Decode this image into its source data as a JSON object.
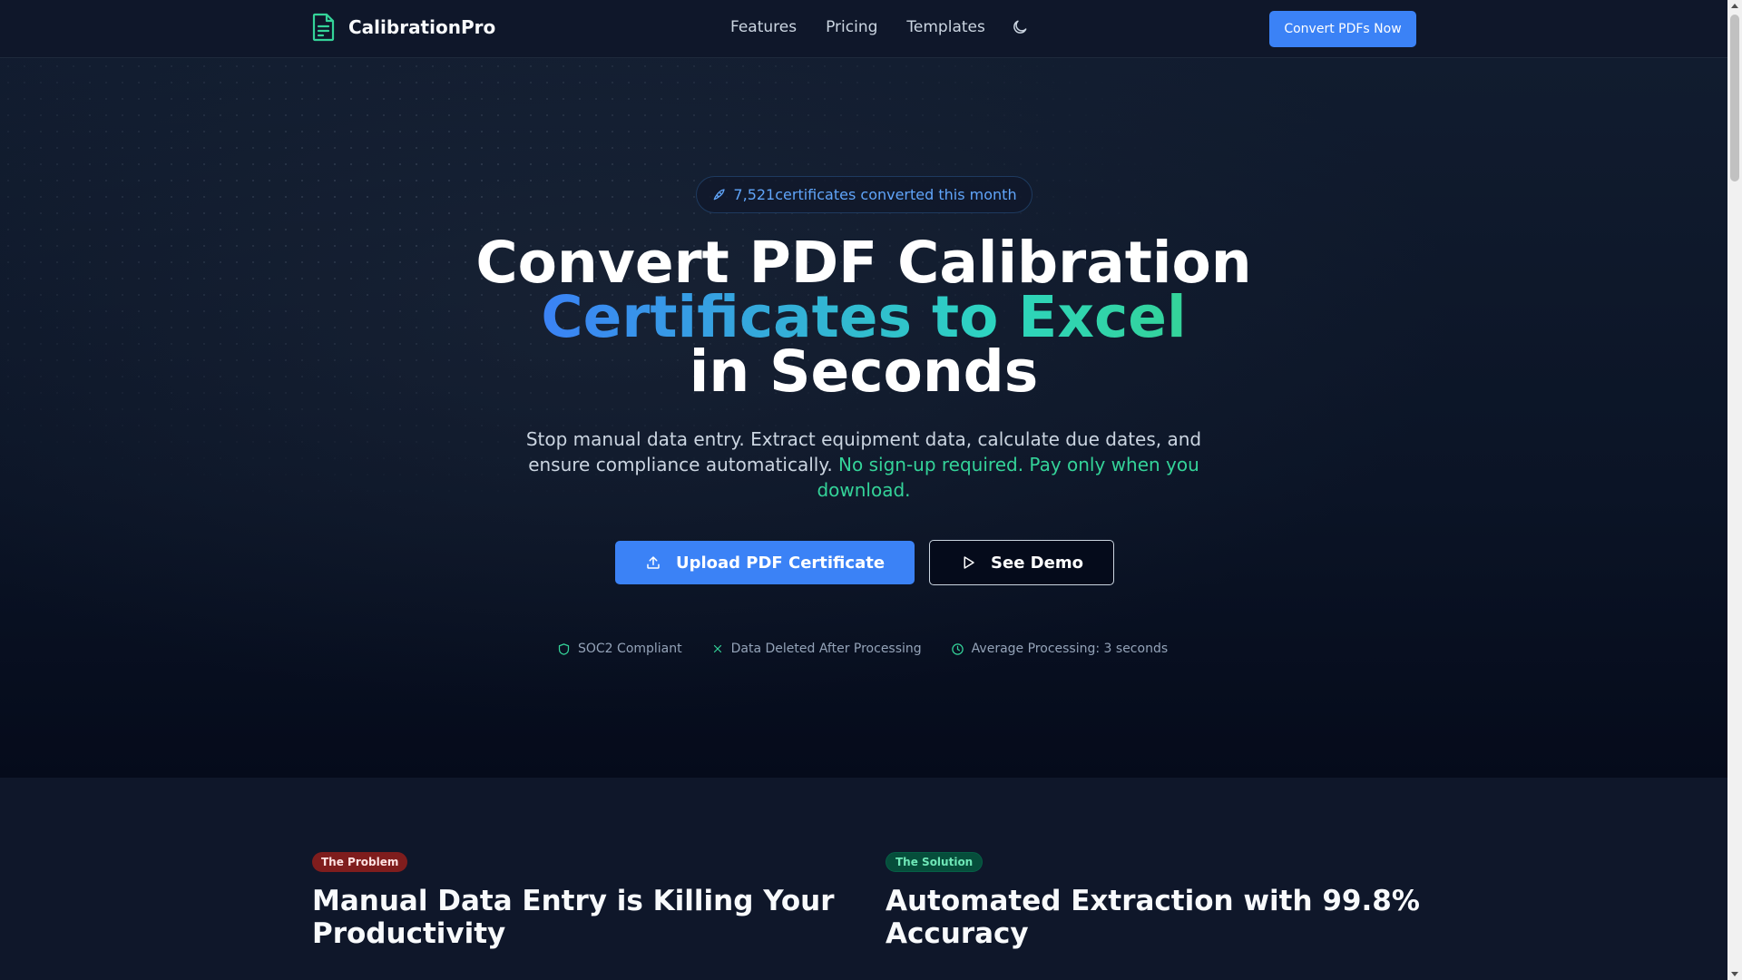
{
  "nav": {
    "brand": "CalibrationPro",
    "links": [
      "Features",
      "Pricing",
      "Templates"
    ],
    "cta": "Convert PDFs Now"
  },
  "hero": {
    "badge_count": "7,521",
    "badge_text": "certificates converted this month",
    "headline_line1": "Convert PDF Calibration",
    "headline_line2": "Certificates to Excel",
    "headline_line3": "in Seconds",
    "subcopy": "Stop manual data entry. Extract equipment data, calculate due dates, and ensure compliance automatically.",
    "subcopy_accent": "No sign-up required. Pay only when you download.",
    "upload_label": "Upload PDF Certificate",
    "demo_label": "See Demo",
    "trust": [
      "SOC2 Compliant",
      "Data Deleted After Processing",
      "Average Processing: 3 seconds"
    ]
  },
  "sections": {
    "problem_tag": "The Problem",
    "problem_title": "Manual Data Entry is Killing Your Productivity",
    "solution_tag": "The Solution",
    "solution_title": "Automated Extraction with 99.8% Accuracy"
  },
  "colors": {
    "background": "#0f172a",
    "primary": "#3b82f6",
    "accent": "#34d399",
    "problem_tag": "#7f1d1d",
    "solution_tag": "#064e3b"
  },
  "icons": {
    "brand": "document-icon",
    "theme": "moon-icon",
    "badge": "rocket-icon",
    "upload": "upload-icon",
    "demo": "play-icon",
    "trust": [
      "shield-icon",
      "x-icon",
      "clock-icon"
    ]
  }
}
